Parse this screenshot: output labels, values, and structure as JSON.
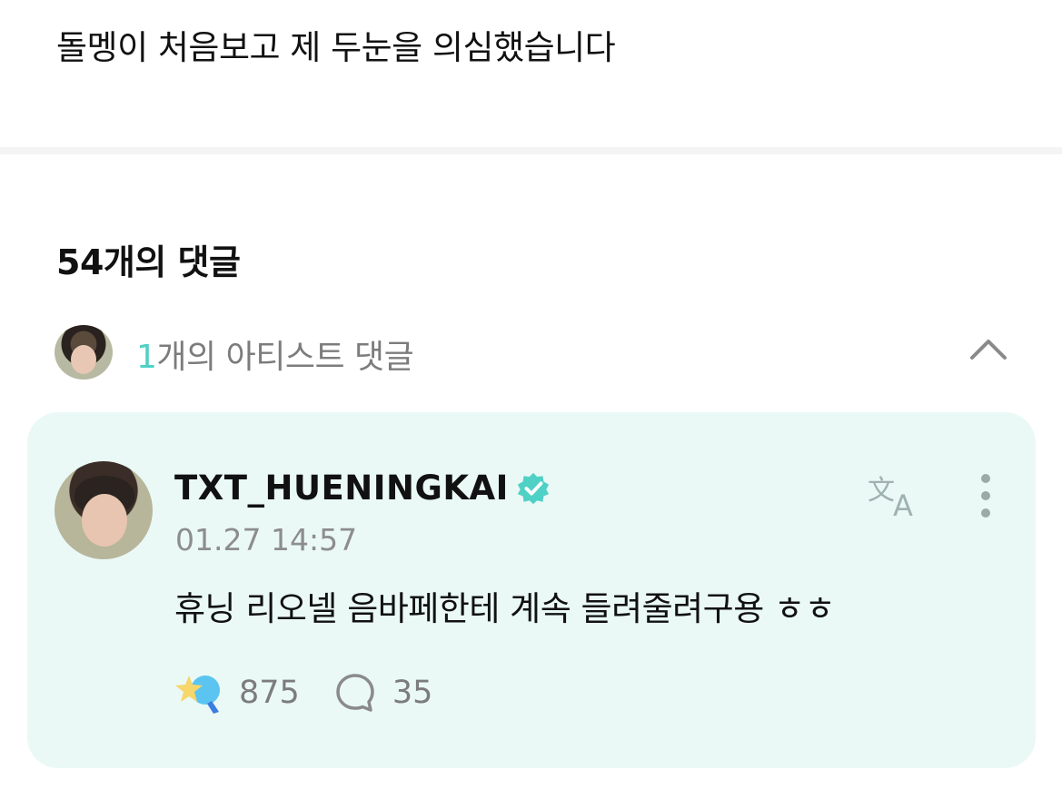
{
  "post": {
    "text": "돌멩이 처음보고 제 두눈을 의심했습니다"
  },
  "comments": {
    "count_title": "54개의 댓글",
    "artist_count": "1",
    "artist_label": "개의 아티스트 댓글"
  },
  "artist_comment": {
    "username": "TXT_HUENINGKAI",
    "timestamp": "01.27 14:57",
    "text": "휴닝 리오넬 음바페한테 계속 들려줄려구용 ㅎㅎ",
    "likes": "875",
    "replies": "35"
  },
  "colors": {
    "accent": "#4fd1c5",
    "card_bg": "#eaf9f6"
  },
  "icons": [
    "chevron-up-icon",
    "verified-icon",
    "translate-icon",
    "more-icon",
    "like-icon",
    "reply-icon"
  ]
}
